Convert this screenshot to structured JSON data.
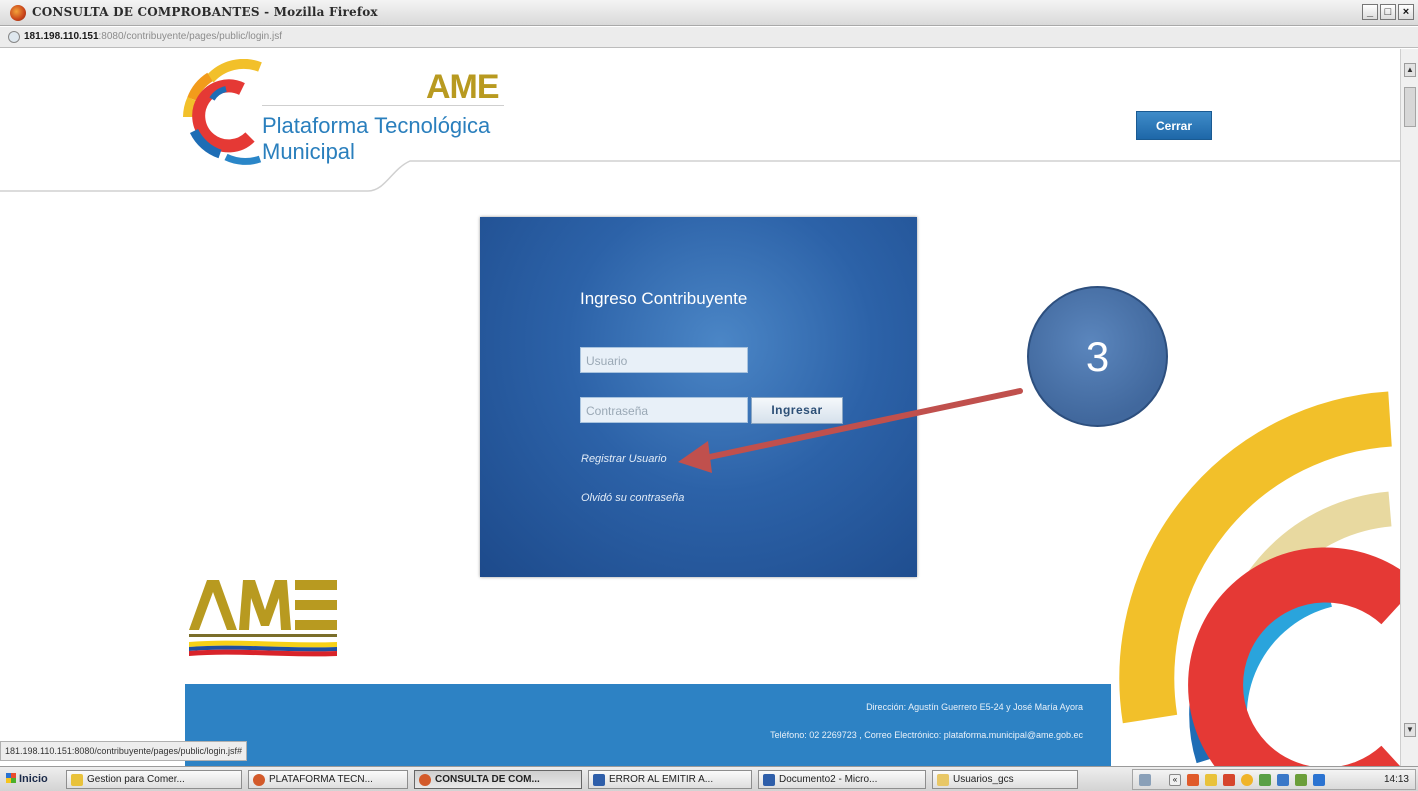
{
  "window": {
    "title": "CONSULTA DE COMPROBANTES - Mozilla Firefox",
    "controls": {
      "minimize": "_",
      "maximize": "□",
      "close": "×"
    }
  },
  "address_bar": {
    "url_host": "181.198.110.151",
    "url_rest": ":8080/contribuyente/pages/public/login.jsf"
  },
  "header": {
    "brand_short": "AME",
    "brand_title": "Plataforma Tecnológica",
    "brand_subtitle": "Municipal",
    "close_button": "Cerrar"
  },
  "login": {
    "title": "Ingreso Contribuyente",
    "username_placeholder": "Usuario",
    "password_placeholder": "Contraseña",
    "submit_button": "Ingresar",
    "register_link": "Registrar Usuario",
    "forgot_link": "Olvidó su contraseña"
  },
  "annotation": {
    "step_number": "3"
  },
  "footer": {
    "address": "Dirección: Agustín Guerrero E5-24 y José María Ayora",
    "contact": "Teléfono: 02 2269723 , Correo Electrónico: plataforma.municipal@ame.gob.ec"
  },
  "status_bar": {
    "url": "181.198.110.151:8080/contribuyente/pages/public/login.jsf#"
  },
  "taskbar": {
    "start_label": "Inicio",
    "tasks": [
      {
        "label": "Gestion para Comer..."
      },
      {
        "label": "PLATAFORMA TECN..."
      },
      {
        "label": "CONSULTA DE COM..."
      },
      {
        "label": "ERROR AL EMITIR A..."
      },
      {
        "label": "Documento2 - Micro..."
      },
      {
        "label": "Usuarios_gcs"
      }
    ],
    "clock": "14:13"
  },
  "colors": {
    "brand_blue": "#2a7fbd",
    "panel_blue": "#2c62a8",
    "footer_blue": "#2d82c4",
    "ame_gold": "#b89a20",
    "annotation_arrow": "#c0504d",
    "annotation_circle": "#4f81bd"
  }
}
